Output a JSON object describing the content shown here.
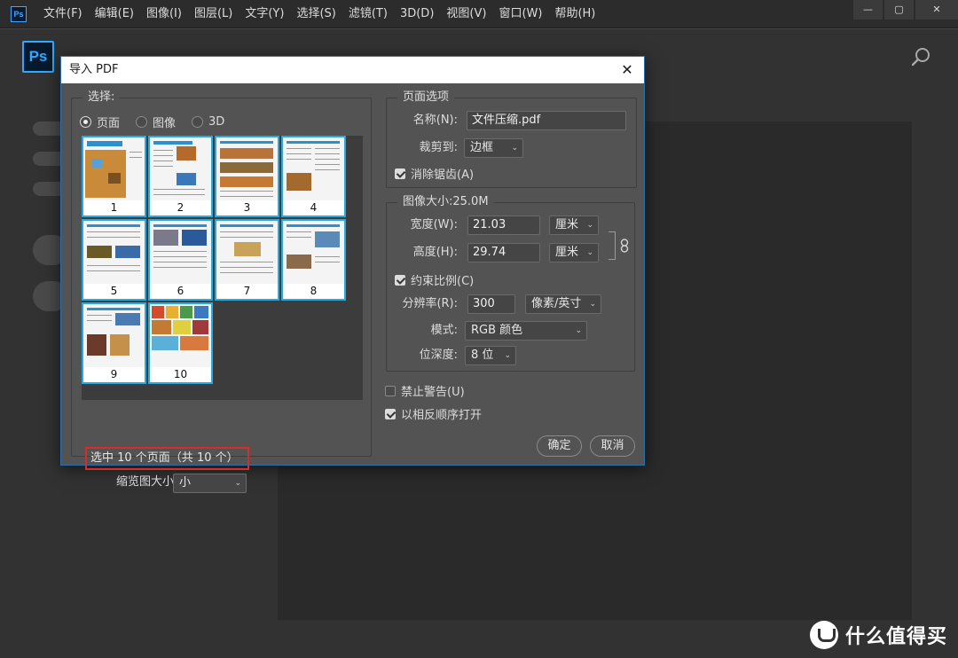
{
  "app": {
    "icon_text": "Ps",
    "menu": [
      "文件(F)",
      "编辑(E)",
      "图像(I)",
      "图层(L)",
      "文字(Y)",
      "选择(S)",
      "滤镜(T)",
      "3D(D)",
      "视图(V)",
      "窗口(W)",
      "帮助(H)"
    ],
    "window_controls": {
      "minimize": "—",
      "maximize": "▢",
      "close": "✕"
    },
    "logo_text": "Ps",
    "search_icon": "search-icon"
  },
  "dialog": {
    "title": "导入 PDF",
    "close": "✕",
    "select_group": {
      "title": "选择:",
      "radios": [
        {
          "label": "页面",
          "checked": true
        },
        {
          "label": "图像",
          "checked": false
        },
        {
          "label": "3D",
          "checked": false
        }
      ],
      "thumbnails": [
        "1",
        "2",
        "3",
        "4",
        "5",
        "6",
        "7",
        "8",
        "9",
        "10"
      ],
      "selected_count": "选中 10 个页面（共 10 个）",
      "thumb_size_label": "缩览图大小:",
      "thumb_size_value": "小"
    },
    "page_options": {
      "title": "页面选项",
      "name_label": "名称(N):",
      "name_value": "文件压缩.pdf",
      "crop_label": "裁剪到:",
      "crop_value": "边框",
      "anti_alias_label": "消除锯齿(A)",
      "anti_alias_checked": true
    },
    "image_size": {
      "title": "图像大小:25.0M",
      "width_label": "宽度(W):",
      "width_value": "21.03",
      "width_unit": "厘米",
      "height_label": "高度(H):",
      "height_value": "29.74",
      "height_unit": "厘米",
      "constrain_label": "约束比例(C)",
      "constrain_checked": true,
      "resolution_label": "分辨率(R):",
      "resolution_value": "300",
      "resolution_unit": "像素/英寸",
      "mode_label": "模式:",
      "mode_value": "RGB 颜色",
      "depth_label": "位深度:",
      "depth_value": "8 位"
    },
    "suppress_warnings_label": "禁止警告(U)",
    "suppress_warnings_checked": false,
    "reverse_order_label": "以相反顺序打开",
    "reverse_order_checked": true,
    "ok_label": "确定",
    "cancel_label": "取消"
  },
  "watermark": {
    "text": "什么值得买"
  },
  "colors": {
    "accent_blue": "#31a8ff",
    "thumb_border": "#29a9e0",
    "highlight_red": "#d42d2d"
  }
}
